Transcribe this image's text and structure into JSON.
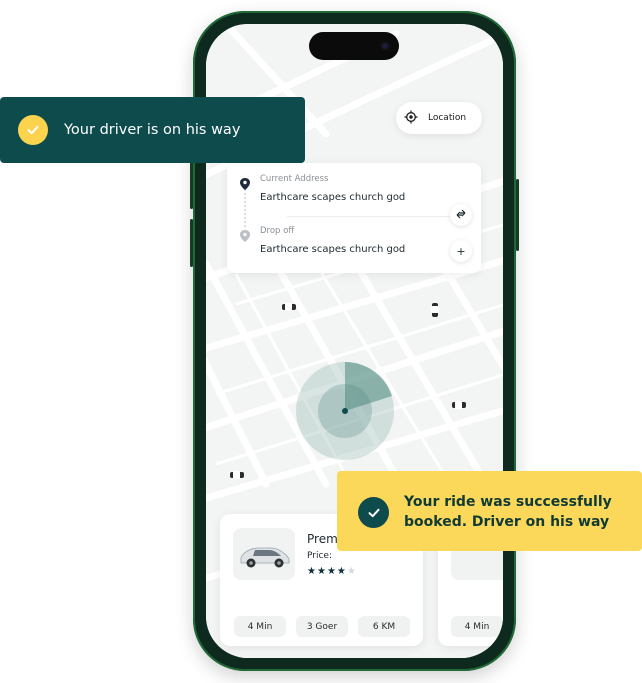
{
  "colors": {
    "brand_dark": "#0d4b4c",
    "accent_yellow": "#fcd85a",
    "phone_frame": "#0e2a1e",
    "map_bg": "#f3f4f4"
  },
  "location_chip": {
    "icon": "crosshair-location-icon",
    "label": "Location"
  },
  "address": {
    "current_label": "Current Address",
    "current_value": "Earthcare scapes church god",
    "dropoff_label": "Drop off",
    "dropoff_value": "Earthcare scapes church god",
    "swap_icon": "swap-arrows-icon",
    "add_symbol": "+"
  },
  "ride_card": {
    "name": "Prem",
    "price_label": "Price:",
    "rating": 4,
    "rating_max": 5,
    "stats": [
      "4 Min",
      "3 Goer",
      "6 KM"
    ]
  },
  "ride_card_2": {
    "stats": [
      "4 Min"
    ]
  },
  "toasts": {
    "driver_on_way": "Your driver is on his way",
    "booked_line1": "Your ride was successfully",
    "booked_line2": "booked. Driver on his way"
  }
}
